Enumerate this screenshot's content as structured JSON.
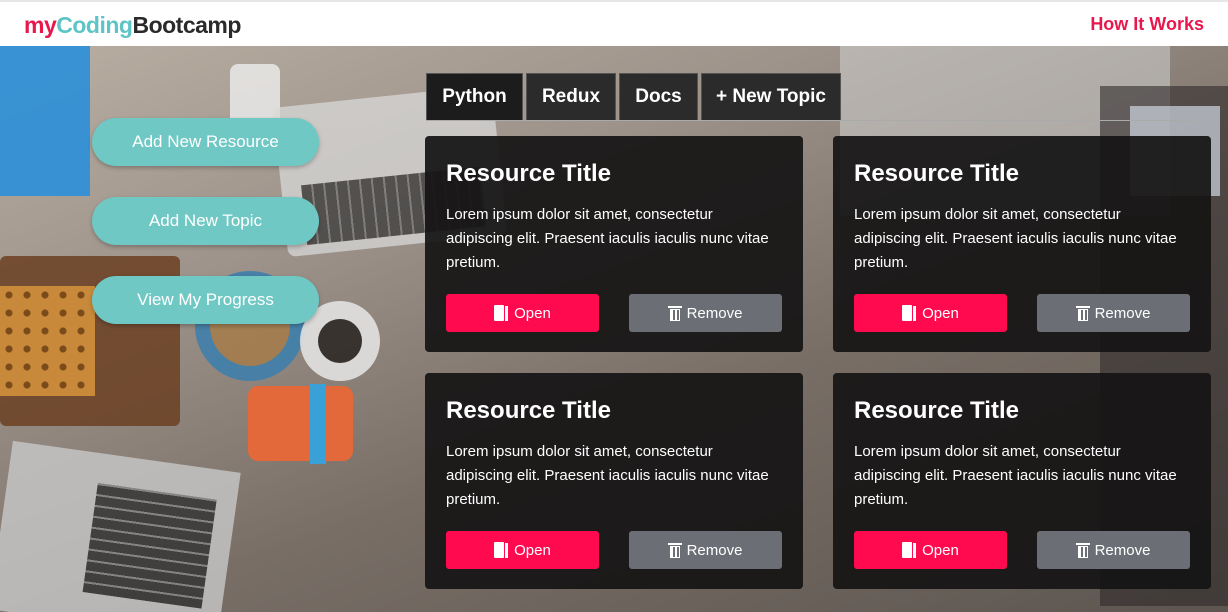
{
  "header": {
    "logo_part1": "my",
    "logo_part2": "Coding",
    "logo_part3": "Bootcamp",
    "nav_link": "How It Works"
  },
  "sidebar": {
    "buttons": [
      "Add New Resource",
      "Add New Topic",
      "View My Progress"
    ]
  },
  "tabs": [
    {
      "label": "Python",
      "active": true
    },
    {
      "label": "Redux",
      "active": false
    },
    {
      "label": "Docs",
      "active": false
    },
    {
      "label": "+ New Topic",
      "active": false
    }
  ],
  "cards": [
    {
      "title": "Resource Title",
      "text": "Lorem ipsum dolor sit amet, consectetur adipiscing elit. Praesent iaculis iaculis nunc vitae pretium.",
      "open_label": "Open",
      "remove_label": "Remove"
    },
    {
      "title": "Resource Title",
      "text": "Lorem ipsum dolor sit amet, consectetur adipiscing elit. Praesent iaculis iaculis nunc vitae pretium.",
      "open_label": "Open",
      "remove_label": "Remove"
    },
    {
      "title": "Resource Title",
      "text": "Lorem ipsum dolor sit amet, consectetur adipiscing elit. Praesent iaculis iaculis nunc vitae pretium.",
      "open_label": "Open",
      "remove_label": "Remove"
    },
    {
      "title": "Resource Title",
      "text": "Lorem ipsum dolor sit amet, consectetur adipiscing elit. Praesent iaculis iaculis nunc vitae pretium.",
      "open_label": "Open",
      "remove_label": "Remove"
    }
  ],
  "colors": {
    "accent": "#e8174c",
    "teal": "#6fc8c4",
    "open_button": "#ff0a4f",
    "remove_button": "#6b6e75"
  },
  "icons": {
    "open": "door-open-icon",
    "remove": "trash-icon"
  }
}
